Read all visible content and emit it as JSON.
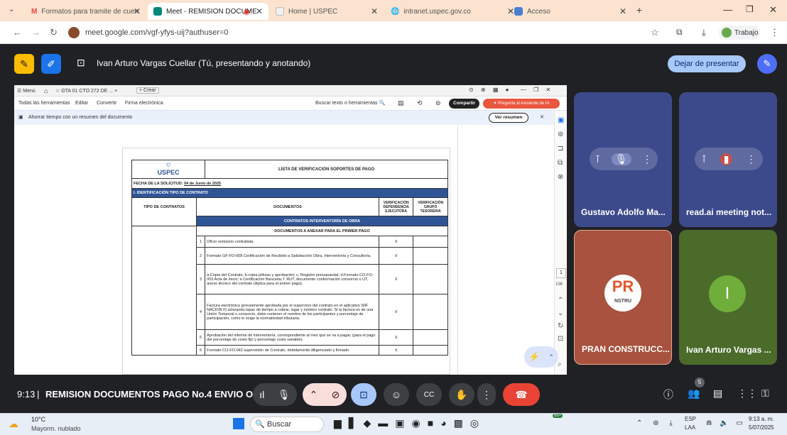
{
  "browser": {
    "tabs": [
      {
        "label": "Formatos para tramite de cuen",
        "icon": "gmail-icon",
        "active": false
      },
      {
        "label": "Meet - REMISION DOCUME",
        "icon": "meet-icon",
        "active": true
      },
      {
        "label": "Home | USPEC",
        "icon": "page-icon",
        "active": false
      },
      {
        "label": "intranet.uspec.gov.co",
        "icon": "globe-icon",
        "active": false
      },
      {
        "label": "Acceso",
        "icon": "page-icon",
        "active": false
      }
    ],
    "url": "meet.google.com/vgf-yfys-uij?authuser=0",
    "profile_label": "Trabajo"
  },
  "meet": {
    "presenter_label": "Ivan Arturo Vargas Cuellar (Tú, presentando y anotando)",
    "stop_presenting": "Dejar de presentar",
    "time": "9:13",
    "separator": "|",
    "meeting_title": "REMISION DOCUMENTOS PAGO No.4 ENVIO OFIC...",
    "participant_count": "5",
    "participants": [
      {
        "name": "Gustavo Adolfo Ma..."
      },
      {
        "name": "read.ai meeting not..."
      },
      {
        "name": "PRAN CONSTRUCC...",
        "logo_text": "PR",
        "logo_sub": "NSTRU"
      },
      {
        "name": "Ivan Arturo Vargas ...",
        "initial": "I"
      }
    ]
  },
  "reader": {
    "menu": "Menú",
    "tab_title": "GTA 01 CTO 272 DE ...",
    "new_tab": "+ Crear",
    "toolbar": [
      "Todas las herramientas",
      "Editar",
      "Convertir",
      "Firma electrónica"
    ],
    "search": "Buscar texto o herramientas",
    "share": "Compartir",
    "ai": "Pregunta al Asistente de IA",
    "summary_banner": "Ahorrar tiempo con un resumen del documento",
    "summary_btn": "Ver resumen",
    "page_num": "1",
    "page_total": "196"
  },
  "doc": {
    "logo": "USPEC",
    "title": "LISTA DE VERIFICACION SOPORTES DE PAGO",
    "fecha": "FECHA DE LA SOLICITUD:",
    "fecha_val": "04 de Junio de 2025",
    "section": "I. IDENTIFICACIÓN TIPO DE CONTRATO",
    "col_tipo": "TIPO DE CONTRATOS",
    "col_docs": "DOCUMENTOS",
    "col_v1": "VERIFICACIÓN DEPENDENCIA EJECUTORA",
    "col_v2": "VERIFICACIÓN GRUPO TESORERIA",
    "band": "CONTRATOS INTERVENTORÍA DE OBRA",
    "sub": "DOCUMENTOS A ANEXAR PARA EL PRIMER PAGO",
    "rows": [
      {
        "n": "1",
        "text": "Oficio remisorio contratista.",
        "x": "X"
      },
      {
        "n": "2",
        "text": "Formato GF-FO-008 Certificación de Recibido a Satisfacción Obra, Interventoría y Consultoría.",
        "x": "X"
      },
      {
        "n": "3",
        "text": "a.Copia del Contrato; b.copia pólizas y aprobación; c. Registro presupuestal; d.Formato CO-FO-003 Acta de Inicio; e.Certificación Bancaria; f. RUT, documento conformación consorcio o UT, anexo técnico del contrato (Aplica para el primer pago).",
        "x": "X"
      },
      {
        "n": "4",
        "text": "Factura electrónica (previamente aprobada por el supervisor del contrato en el aplicativo SIIF NACION II) aclarando lapso de tiempo a cobrar, lugar y número contrato. Si la factura es de una Unión Temporal o consorcio, debe contener el nombre de los participantes y porcentaje de participación, como lo exige la normatividad tributaria.",
        "x": "X"
      },
      {
        "n": "5",
        "text": "Aprobación del informe de interventoría, correspondiente al mes que se va a pagar, (para el pago del porcentaje de costo fijo y porcentaje costo variable).",
        "x": "X"
      },
      {
        "n": "6",
        "text": "Formato CO-FO-042 supervisión de Contrato, debidamente diligenciado y firmado.",
        "x": "X"
      }
    ]
  },
  "taskbar": {
    "temp": "10°C",
    "weather": "Mayorm. nublado",
    "search": "Buscar",
    "lang1": "ESP",
    "lang2": "LAA",
    "clock": "9:13 a. m.",
    "date": "5/07/2025",
    "badge": "99+"
  },
  "colors": {
    "accent": "#1a73e8",
    "end_call": "#ea4335",
    "band": "#2f5597",
    "tile_blue": "#3c4a8c",
    "tile_red": "#a8523f",
    "tile_green": "#4b6b2a"
  }
}
